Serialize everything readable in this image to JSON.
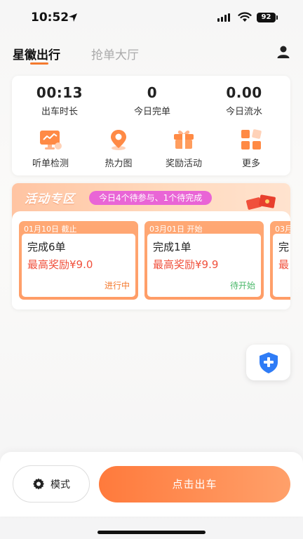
{
  "status_bar": {
    "time": "10:52",
    "battery": "92"
  },
  "tabs": {
    "active": "星徽出行",
    "inactive": "抢单大厅"
  },
  "stats": [
    {
      "value": "00:13",
      "label": "出车时长"
    },
    {
      "value": "0",
      "label": "今日完单"
    },
    {
      "value": "0.00",
      "label": "今日流水"
    }
  ],
  "shortcuts": [
    {
      "label": "听单检测",
      "icon": "monitor-icon"
    },
    {
      "label": "热力图",
      "icon": "map-pin-icon"
    },
    {
      "label": "奖励活动",
      "icon": "gift-icon"
    },
    {
      "label": "更多",
      "icon": "grid-icon"
    }
  ],
  "activity": {
    "title": "活动专区",
    "summary": "今日4个待参与、1个待完成",
    "cards": [
      {
        "date": "01月10日 截止",
        "name": "完成6单",
        "reward": "最高奖励¥9.0",
        "status": "进行中",
        "status_color": "#f47a2f"
      },
      {
        "date": "03月01日 开始",
        "name": "完成1单",
        "reward": "最高奖励¥9.9",
        "status": "待开始",
        "status_color": "#4cb96b"
      },
      {
        "date": "03月",
        "name": "完",
        "reward": "最",
        "status": "",
        "status_color": "#f47a2f"
      }
    ]
  },
  "bottom": {
    "mode_label": "模式",
    "depart_label": "点击出车"
  },
  "colors": {
    "accent": "#f47a2f",
    "reward": "#f0503c",
    "pill": "#e965d6",
    "fab_shield": "#2f7cf6"
  }
}
